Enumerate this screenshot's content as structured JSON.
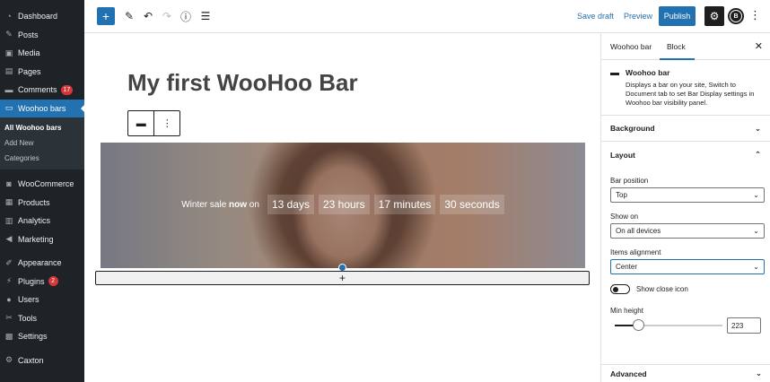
{
  "admin_menu": {
    "items": [
      {
        "label": "Dashboard",
        "icon": "dashboard-icon",
        "glyph": "◔"
      },
      {
        "label": "Posts",
        "icon": "pin-icon",
        "glyph": "✎"
      },
      {
        "label": "Media",
        "icon": "media-icon",
        "glyph": "▣"
      },
      {
        "label": "Pages",
        "icon": "page-icon",
        "glyph": "▤"
      },
      {
        "label": "Comments",
        "icon": "comment-icon",
        "glyph": "▬",
        "badge": "17"
      },
      {
        "label": "Woohoo bars",
        "icon": "bar-icon",
        "glyph": "▭",
        "active": true
      }
    ],
    "submenu": [
      "All Woohoo bars",
      "Add New",
      "Categories"
    ],
    "items2": [
      {
        "label": "WooCommerce",
        "icon": "woo-icon",
        "glyph": "◙"
      },
      {
        "label": "Products",
        "icon": "box-icon",
        "glyph": "▦"
      },
      {
        "label": "Analytics",
        "icon": "analytics-icon",
        "glyph": "▥"
      },
      {
        "label": "Marketing",
        "icon": "megaphone-icon",
        "glyph": "◀"
      }
    ],
    "items3": [
      {
        "label": "Appearance",
        "icon": "brush-icon",
        "glyph": "✐"
      },
      {
        "label": "Plugins",
        "icon": "plugin-icon",
        "glyph": "⚡",
        "badge": "2"
      },
      {
        "label": "Users",
        "icon": "user-icon",
        "glyph": "●"
      },
      {
        "label": "Tools",
        "icon": "wrench-icon",
        "glyph": "✂"
      },
      {
        "label": "Settings",
        "icon": "settings-icon",
        "glyph": "▩"
      }
    ],
    "items4": [
      {
        "label": "Caxton",
        "icon": "gear-icon",
        "glyph": "⚙"
      }
    ]
  },
  "toolbar": {
    "save_draft": "Save draft",
    "preview": "Preview",
    "publish": "Publish",
    "plugin_letter": "B",
    "accent": "#2271b1"
  },
  "editor": {
    "title": "My first WooHoo Bar",
    "bar": {
      "lead_pre": "Winter sale ",
      "lead_bold": "now",
      "lead_post": " on",
      "days": "13 days",
      "hours": "23 hours",
      "minutes": "17 minutes",
      "seconds": "30 seconds"
    },
    "appender": "+"
  },
  "sidebar": {
    "tabs": [
      "Woohoo bar",
      "Block"
    ],
    "close": "✕",
    "block": {
      "title": "Woohoo bar",
      "description": "Displays a bar on your site, Switch to Document tab to set Bar Display settings in Woohoo bar visibility panel."
    },
    "panels": {
      "background": "Background",
      "layout": "Layout",
      "advanced": "Advanced"
    },
    "layout": {
      "bar_position_label": "Bar position",
      "bar_position_value": "Top",
      "show_on_label": "Show on",
      "show_on_value": "On all devices",
      "alignment_label": "Items alignment",
      "alignment_value": "Center",
      "close_icon_label": "Show close icon",
      "close_icon_on": false,
      "min_height_label": "Min height",
      "min_height_value": "223",
      "min_height_fraction": 0.22
    }
  }
}
